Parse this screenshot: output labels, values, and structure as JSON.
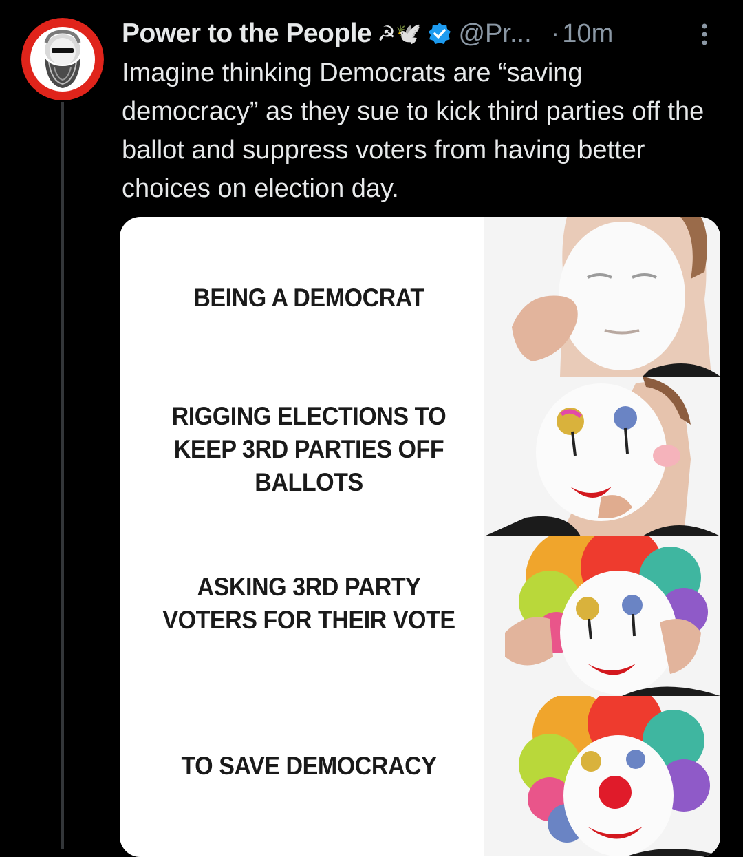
{
  "post": {
    "author": {
      "display_name": "Power to the People",
      "name_emojis": "☭🕊️",
      "handle": "@Pr...",
      "verified": true,
      "avatar": "marx-portrait-icon"
    },
    "separator": "·",
    "time": "10m",
    "more_icon": "more-vertical-icon",
    "text": "Imagine thinking Democrats are “saving democracy” as they sue to kick third parties off the ballot and suppress voters from having better choices on election day."
  },
  "meme": {
    "template": "clown-makeup",
    "panels": [
      {
        "caption": "BEING A DEMOCRAT",
        "image": "clown-stage-1-white-face"
      },
      {
        "caption": "RIGGING ELECTIONS TO KEEP 3RD PARTIES OFF BALLOTS",
        "image": "clown-stage-2-face-paint"
      },
      {
        "caption": "ASKING 3RD PARTY VOTERS FOR THEIR VOTE",
        "image": "clown-stage-3-rainbow-wig"
      },
      {
        "caption": "TO SAVE DEMOCRACY",
        "image": "clown-stage-4-red-nose"
      }
    ]
  },
  "colors": {
    "background": "#000000",
    "text_primary": "#e7e9ea",
    "text_secondary": "#8b98a5",
    "verified_blue": "#1d9bf0",
    "avatar_ring": "#e0241b",
    "thread_line": "#333639"
  }
}
